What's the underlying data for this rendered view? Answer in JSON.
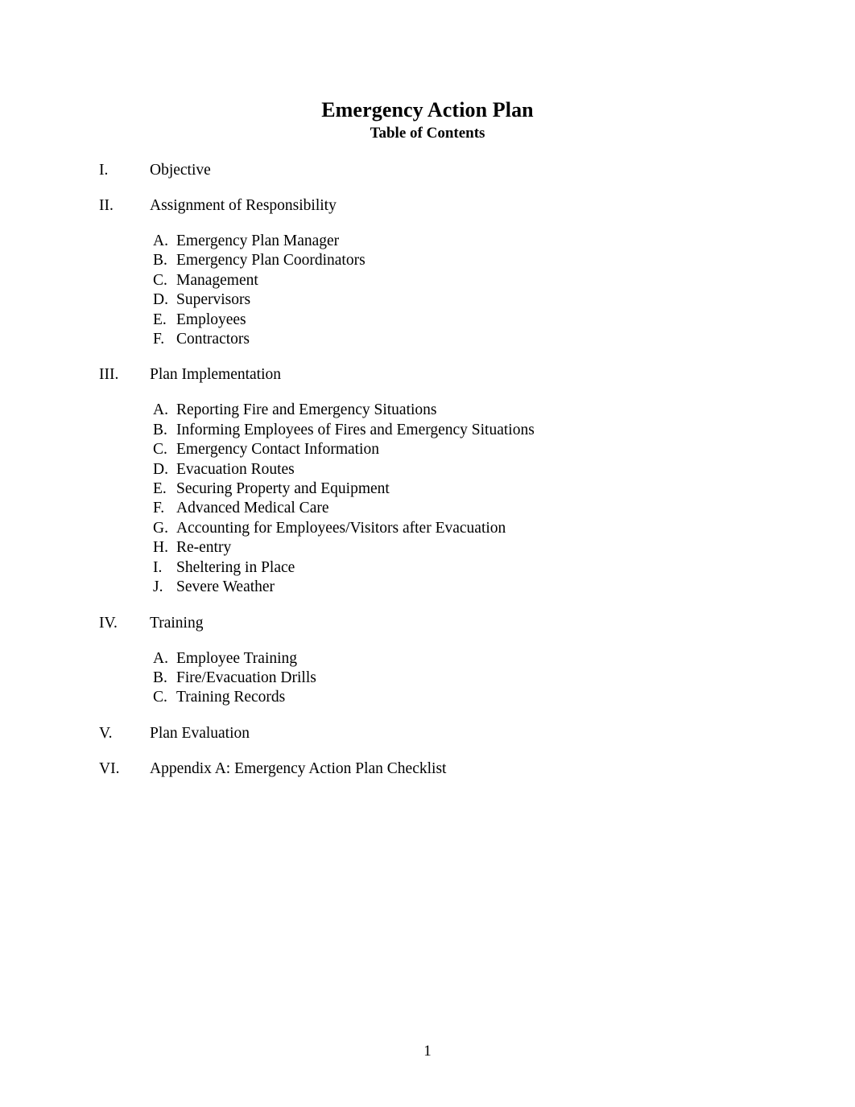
{
  "document": {
    "title": "Emergency Action Plan",
    "subtitle": "Table of Contents"
  },
  "toc": {
    "sections": [
      {
        "numeral": "I.",
        "title": "Objective",
        "subitems": []
      },
      {
        "numeral": "II.",
        "title": "Assignment of Responsibility",
        "subitems": [
          {
            "letter": "A.",
            "text": "Emergency Plan Manager"
          },
          {
            "letter": "B.",
            "text": "Emergency Plan Coordinators"
          },
          {
            "letter": "C.",
            "text": "Management"
          },
          {
            "letter": "D.",
            "text": "Supervisors"
          },
          {
            "letter": "E.",
            "text": "Employees"
          },
          {
            "letter": "F.",
            "text": "Contractors"
          }
        ]
      },
      {
        "numeral": "III.",
        "title": "Plan Implementation",
        "subitems": [
          {
            "letter": "A.",
            "text": "Reporting Fire and Emergency Situations"
          },
          {
            "letter": "B.",
            "text": "Informing Employees of Fires and Emergency Situations"
          },
          {
            "letter": "C.",
            "text": "Emergency Contact Information"
          },
          {
            "letter": "D.",
            "text": "Evacuation Routes"
          },
          {
            "letter": "E.",
            "text": "Securing Property and Equipment"
          },
          {
            "letter": "F.",
            "text": "Advanced Medical Care"
          },
          {
            "letter": "G.",
            "text": "Accounting for Employees/Visitors after Evacuation"
          },
          {
            "letter": "H.",
            "text": "Re-entry"
          },
          {
            "letter": "I.",
            "text": "Sheltering in Place"
          },
          {
            "letter": "J.",
            "text": "Severe Weather"
          }
        ]
      },
      {
        "numeral": "IV.",
        "title": "Training",
        "subitems": [
          {
            "letter": "A.",
            "text": "Employee Training"
          },
          {
            "letter": "B.",
            "text": "Fire/Evacuation Drills"
          },
          {
            "letter": "C.",
            "text": "Training Records"
          }
        ]
      },
      {
        "numeral": "V.",
        "title": "Plan Evaluation",
        "subitems": []
      },
      {
        "numeral": "VI.",
        "title": "Appendix A:  Emergency Action Plan Checklist",
        "subitems": []
      }
    ]
  },
  "footer": {
    "page_number": "1"
  }
}
